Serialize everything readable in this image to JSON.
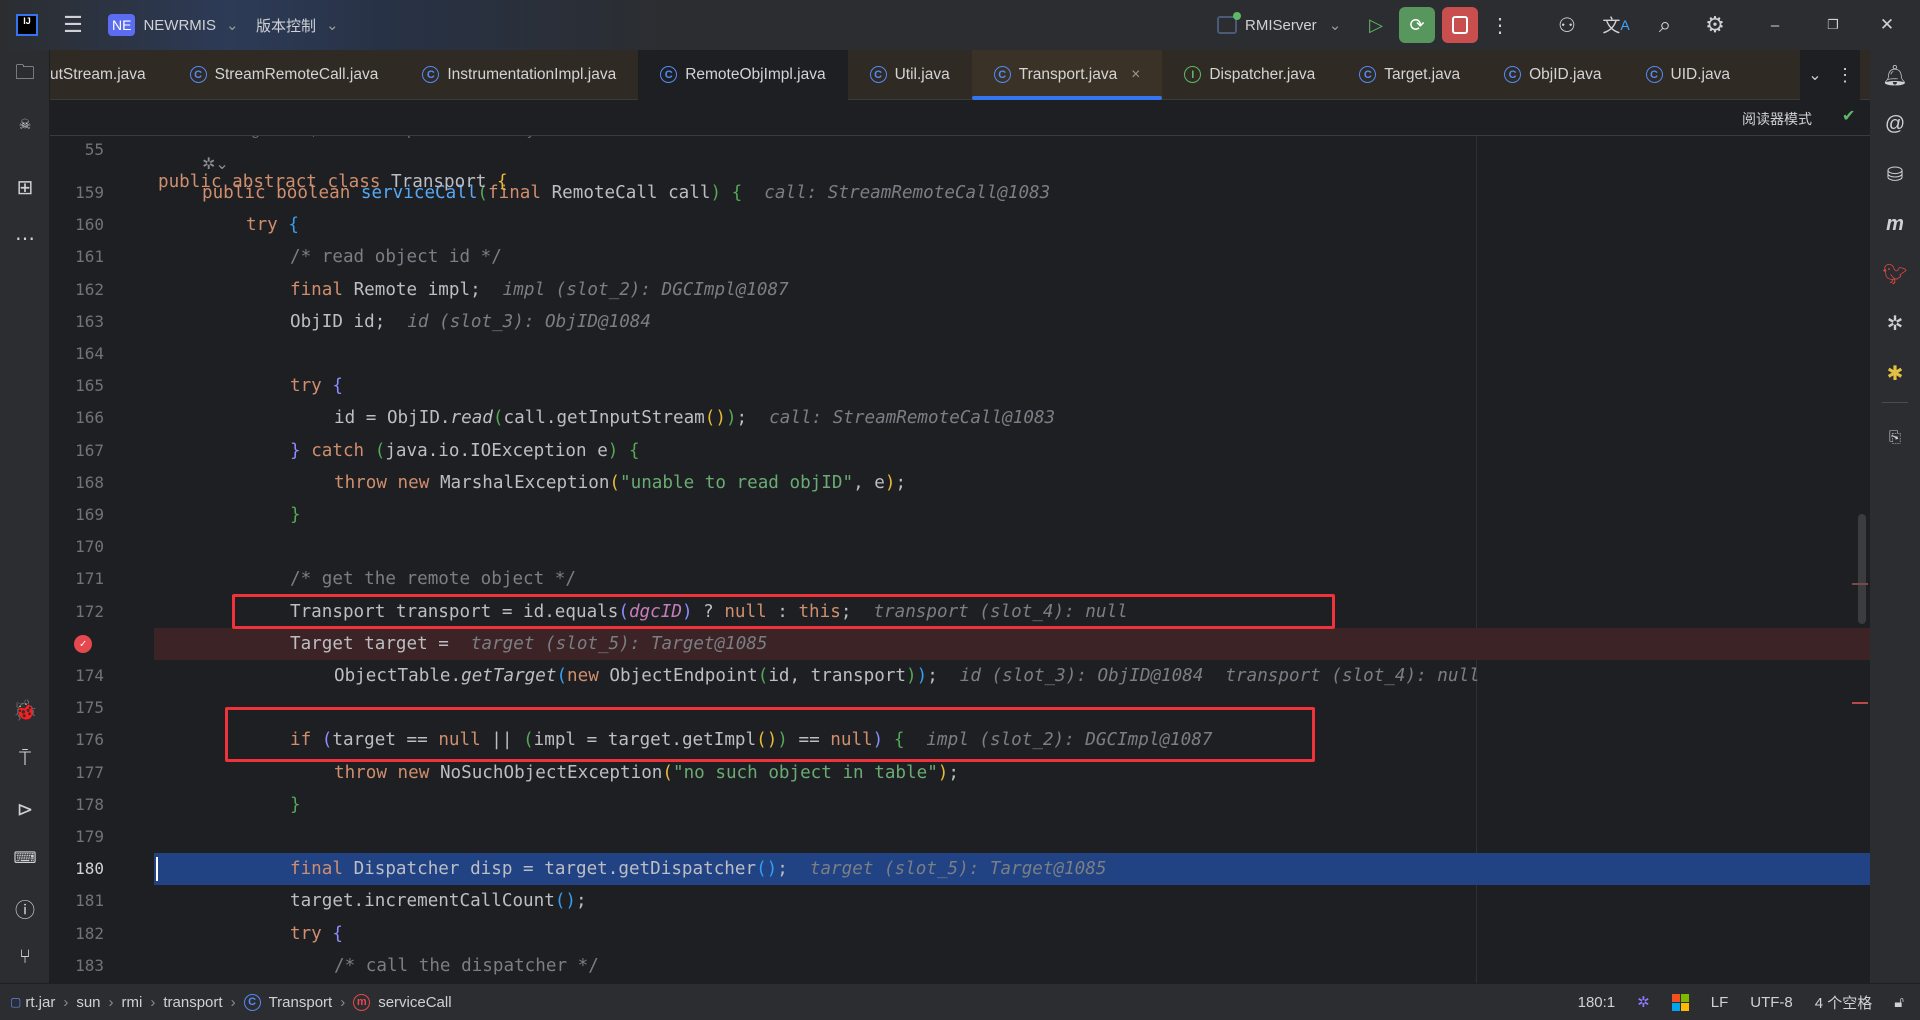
{
  "titlebar": {
    "project_badge": "NE",
    "project": "NEWRMIS",
    "vcs": "版本控制",
    "run_config": "RMIServer"
  },
  "tabs": [
    {
      "label": "utStream.java",
      "icon": "class"
    },
    {
      "label": "StreamRemoteCall.java",
      "icon": "class"
    },
    {
      "label": "InstrumentationImpl.java",
      "icon": "class"
    },
    {
      "label": "RemoteObjImpl.java",
      "icon": "class"
    },
    {
      "label": "Util.java",
      "icon": "class-locked"
    },
    {
      "label": "Transport.java",
      "icon": "class",
      "active": true
    },
    {
      "label": "Dispatcher.java",
      "icon": "interface"
    },
    {
      "label": "Target.java",
      "icon": "class-locked"
    },
    {
      "label": "ObjID.java",
      "icon": "class-locked"
    },
    {
      "label": "UID.java",
      "icon": "class-locked"
    }
  ],
  "editor": {
    "reader_mode": "阅读器模式",
    "sticky": {
      "num": "55",
      "segs": [
        [
          "kw",
          "public abstract class "
        ],
        [
          "txt",
          "Transport "
        ],
        [
          "br1",
          "{"
        ]
      ]
    },
    "fold_comment": "during the call, and the transport should destroy the connection.",
    "lines": [
      {
        "num": "159",
        "ind": 1,
        "segs": [
          [
            "kw",
            "public boolean "
          ],
          [
            "fn",
            "serviceCall"
          ],
          [
            "br2",
            "("
          ],
          [
            "kw",
            "final "
          ],
          [
            "txt",
            "RemoteCall call"
          ],
          [
            "br2",
            ")"
          ],
          [
            "txt",
            " "
          ],
          [
            "br2",
            "{"
          ],
          [
            "hint",
            "call: StreamRemoteCall@1083"
          ]
        ]
      },
      {
        "num": "160",
        "ind": 2,
        "segs": [
          [
            "kw",
            "try "
          ],
          [
            "br3",
            "{"
          ]
        ]
      },
      {
        "num": "161",
        "ind": 3,
        "segs": [
          [
            "cm",
            "/* read object id */"
          ]
        ]
      },
      {
        "num": "162",
        "ind": 3,
        "segs": [
          [
            "kw",
            "final "
          ],
          [
            "txt",
            "Remote impl;"
          ],
          [
            "hint",
            "impl (slot_2): DGCImpl@1087"
          ]
        ]
      },
      {
        "num": "163",
        "ind": 3,
        "segs": [
          [
            "txt",
            "ObjID id;"
          ],
          [
            "hint",
            "id (slot_3): ObjID@1084"
          ]
        ]
      },
      {
        "num": "164",
        "ind": 3,
        "segs": []
      },
      {
        "num": "165",
        "ind": 3,
        "segs": [
          [
            "kw",
            "try "
          ],
          [
            "br4",
            "{"
          ]
        ]
      },
      {
        "num": "166",
        "ind": 4,
        "segs": [
          [
            "txt",
            "id = ObjID."
          ],
          [
            "it",
            "read"
          ],
          [
            "br2",
            "("
          ],
          [
            "txt",
            "call.getInputStream"
          ],
          [
            "br1",
            "()"
          ],
          [
            "br2",
            ")"
          ],
          [
            "txt",
            ";"
          ],
          [
            "hint",
            "call: StreamRemoteCall@1083"
          ]
        ]
      },
      {
        "num": "167",
        "ind": 3,
        "segs": [
          [
            "br4",
            "} "
          ],
          [
            "kw",
            "catch "
          ],
          [
            "br2",
            "("
          ],
          [
            "txt",
            "java.io.IOException e"
          ],
          [
            "br2",
            ")"
          ],
          [
            "txt",
            " "
          ],
          [
            "br2",
            "{"
          ]
        ]
      },
      {
        "num": "168",
        "ind": 4,
        "segs": [
          [
            "kw",
            "throw new "
          ],
          [
            "txt",
            "MarshalException"
          ],
          [
            "br1",
            "("
          ],
          [
            "str",
            "\"unable to read objID\""
          ],
          [
            "txt",
            ", e"
          ],
          [
            "br1",
            ")"
          ],
          [
            "txt",
            ";"
          ]
        ]
      },
      {
        "num": "169",
        "ind": 3,
        "segs": [
          [
            "br2",
            "}"
          ]
        ]
      },
      {
        "num": "170",
        "ind": 3,
        "segs": []
      },
      {
        "num": "171",
        "ind": 3,
        "segs": [
          [
            "cm",
            "/* get the remote object */"
          ]
        ]
      },
      {
        "num": "172",
        "ind": 3,
        "segs": [
          [
            "txt",
            "Transport transport = id.equals"
          ],
          [
            "br4",
            "("
          ],
          [
            "fld",
            "dgcID"
          ],
          [
            "br4",
            ")"
          ],
          [
            "txt",
            " ? "
          ],
          [
            "kw",
            "null "
          ],
          [
            "txt",
            ": "
          ],
          [
            "kw",
            "this"
          ],
          [
            "txt",
            ";"
          ],
          [
            "hint",
            "transport (slot_4): null"
          ]
        ]
      },
      {
        "num": "",
        "ind": 3,
        "hl": "red",
        "bp": true,
        "segs": [
          [
            "txt",
            "Target target ="
          ],
          [
            "hint",
            "target (slot_5): Target@1085"
          ]
        ]
      },
      {
        "num": "174",
        "ind": 4,
        "segs": [
          [
            "txt",
            "ObjectTable."
          ],
          [
            "it",
            "getTarget"
          ],
          [
            "br3",
            "("
          ],
          [
            "kw",
            "new "
          ],
          [
            "txt",
            "ObjectEndpoint"
          ],
          [
            "br2",
            "("
          ],
          [
            "txt",
            "id, transport"
          ],
          [
            "br2",
            ")"
          ],
          [
            "br3",
            ")"
          ],
          [
            "txt",
            ";"
          ],
          [
            "hint",
            "id (slot_3): ObjID@1084"
          ],
          [
            "hint",
            "transport (slot_4): null"
          ]
        ]
      },
      {
        "num": "175",
        "ind": 3,
        "segs": []
      },
      {
        "num": "176",
        "ind": 3,
        "segs": [
          [
            "kw",
            "if "
          ],
          [
            "br4",
            "("
          ],
          [
            "txt",
            "target == "
          ],
          [
            "kw",
            "null "
          ],
          [
            "txt",
            "|| "
          ],
          [
            "br2",
            "("
          ],
          [
            "txt",
            "impl = target.getImpl"
          ],
          [
            "br1",
            "()"
          ],
          [
            "br2",
            ")"
          ],
          [
            "txt",
            " == "
          ],
          [
            "kw",
            "null"
          ],
          [
            "br4",
            ")"
          ],
          [
            "txt",
            " "
          ],
          [
            "br2",
            "{"
          ],
          [
            "hint",
            "impl (slot_2): DGCImpl@1087"
          ]
        ]
      },
      {
        "num": "177",
        "ind": 4,
        "segs": [
          [
            "kw",
            "throw new "
          ],
          [
            "txt",
            "NoSuchObjectException"
          ],
          [
            "br1",
            "("
          ],
          [
            "str",
            "\"no such object in table\""
          ],
          [
            "br1",
            ")"
          ],
          [
            "txt",
            ";"
          ]
        ]
      },
      {
        "num": "178",
        "ind": 3,
        "segs": [
          [
            "br2",
            "}"
          ]
        ]
      },
      {
        "num": "179",
        "ind": 3,
        "segs": []
      },
      {
        "num": "180",
        "ind": 3,
        "hl": "blue",
        "segs": [
          [
            "kw",
            "final "
          ],
          [
            "txt",
            "Dispatcher disp = target.getDispatcher"
          ],
          [
            "br3",
            "()"
          ],
          [
            "txt",
            ";"
          ],
          [
            "hint",
            "target (slot_5): Target@1085"
          ]
        ]
      },
      {
        "num": "181",
        "ind": 3,
        "segs": [
          [
            "txt",
            "target.incrementCallCount"
          ],
          [
            "br3",
            "()"
          ],
          [
            "txt",
            ";"
          ]
        ]
      },
      {
        "num": "182",
        "ind": 3,
        "segs": [
          [
            "kw",
            "try "
          ],
          [
            "br4",
            "{"
          ]
        ]
      },
      {
        "num": "183",
        "ind": 4,
        "segs": [
          [
            "cm",
            "/* call the dispatcher */"
          ]
        ]
      }
    ]
  },
  "statusbar": {
    "crumbs": [
      "rt.jar",
      "sun",
      "rmi",
      "transport",
      "Transport",
      "serviceCall"
    ],
    "position": "180:1",
    "line_sep": "LF",
    "encoding": "UTF-8",
    "indent": "4 个空格"
  },
  "colors": {
    "accent": "#3574f0",
    "breakpoint_line": "#3b2326",
    "execution_line": "#214283",
    "annotation_box": "#f0323a",
    "debug_button": "#57965c",
    "stop_button": "#c94f4f"
  }
}
